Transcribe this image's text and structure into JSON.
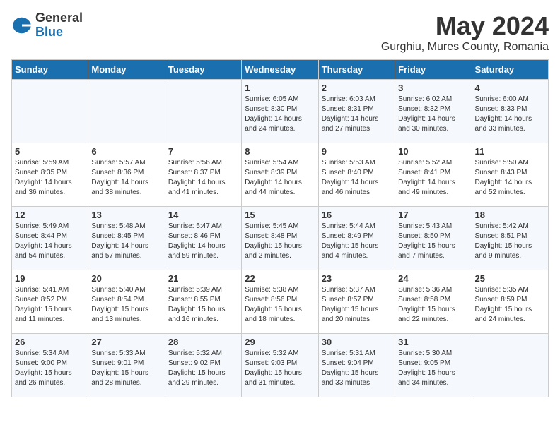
{
  "logo": {
    "general": "General",
    "blue": "Blue"
  },
  "title": "May 2024",
  "subtitle": "Gurghiu, Mures County, Romania",
  "headers": [
    "Sunday",
    "Monday",
    "Tuesday",
    "Wednesday",
    "Thursday",
    "Friday",
    "Saturday"
  ],
  "weeks": [
    [
      {
        "day": "",
        "info": ""
      },
      {
        "day": "",
        "info": ""
      },
      {
        "day": "",
        "info": ""
      },
      {
        "day": "1",
        "info": "Sunrise: 6:05 AM\nSunset: 8:30 PM\nDaylight: 14 hours\nand 24 minutes."
      },
      {
        "day": "2",
        "info": "Sunrise: 6:03 AM\nSunset: 8:31 PM\nDaylight: 14 hours\nand 27 minutes."
      },
      {
        "day": "3",
        "info": "Sunrise: 6:02 AM\nSunset: 8:32 PM\nDaylight: 14 hours\nand 30 minutes."
      },
      {
        "day": "4",
        "info": "Sunrise: 6:00 AM\nSunset: 8:33 PM\nDaylight: 14 hours\nand 33 minutes."
      }
    ],
    [
      {
        "day": "5",
        "info": "Sunrise: 5:59 AM\nSunset: 8:35 PM\nDaylight: 14 hours\nand 36 minutes."
      },
      {
        "day": "6",
        "info": "Sunrise: 5:57 AM\nSunset: 8:36 PM\nDaylight: 14 hours\nand 38 minutes."
      },
      {
        "day": "7",
        "info": "Sunrise: 5:56 AM\nSunset: 8:37 PM\nDaylight: 14 hours\nand 41 minutes."
      },
      {
        "day": "8",
        "info": "Sunrise: 5:54 AM\nSunset: 8:39 PM\nDaylight: 14 hours\nand 44 minutes."
      },
      {
        "day": "9",
        "info": "Sunrise: 5:53 AM\nSunset: 8:40 PM\nDaylight: 14 hours\nand 46 minutes."
      },
      {
        "day": "10",
        "info": "Sunrise: 5:52 AM\nSunset: 8:41 PM\nDaylight: 14 hours\nand 49 minutes."
      },
      {
        "day": "11",
        "info": "Sunrise: 5:50 AM\nSunset: 8:43 PM\nDaylight: 14 hours\nand 52 minutes."
      }
    ],
    [
      {
        "day": "12",
        "info": "Sunrise: 5:49 AM\nSunset: 8:44 PM\nDaylight: 14 hours\nand 54 minutes."
      },
      {
        "day": "13",
        "info": "Sunrise: 5:48 AM\nSunset: 8:45 PM\nDaylight: 14 hours\nand 57 minutes."
      },
      {
        "day": "14",
        "info": "Sunrise: 5:47 AM\nSunset: 8:46 PM\nDaylight: 14 hours\nand 59 minutes."
      },
      {
        "day": "15",
        "info": "Sunrise: 5:45 AM\nSunset: 8:48 PM\nDaylight: 15 hours\nand 2 minutes."
      },
      {
        "day": "16",
        "info": "Sunrise: 5:44 AM\nSunset: 8:49 PM\nDaylight: 15 hours\nand 4 minutes."
      },
      {
        "day": "17",
        "info": "Sunrise: 5:43 AM\nSunset: 8:50 PM\nDaylight: 15 hours\nand 7 minutes."
      },
      {
        "day": "18",
        "info": "Sunrise: 5:42 AM\nSunset: 8:51 PM\nDaylight: 15 hours\nand 9 minutes."
      }
    ],
    [
      {
        "day": "19",
        "info": "Sunrise: 5:41 AM\nSunset: 8:52 PM\nDaylight: 15 hours\nand 11 minutes."
      },
      {
        "day": "20",
        "info": "Sunrise: 5:40 AM\nSunset: 8:54 PM\nDaylight: 15 hours\nand 13 minutes."
      },
      {
        "day": "21",
        "info": "Sunrise: 5:39 AM\nSunset: 8:55 PM\nDaylight: 15 hours\nand 16 minutes."
      },
      {
        "day": "22",
        "info": "Sunrise: 5:38 AM\nSunset: 8:56 PM\nDaylight: 15 hours\nand 18 minutes."
      },
      {
        "day": "23",
        "info": "Sunrise: 5:37 AM\nSunset: 8:57 PM\nDaylight: 15 hours\nand 20 minutes."
      },
      {
        "day": "24",
        "info": "Sunrise: 5:36 AM\nSunset: 8:58 PM\nDaylight: 15 hours\nand 22 minutes."
      },
      {
        "day": "25",
        "info": "Sunrise: 5:35 AM\nSunset: 8:59 PM\nDaylight: 15 hours\nand 24 minutes."
      }
    ],
    [
      {
        "day": "26",
        "info": "Sunrise: 5:34 AM\nSunset: 9:00 PM\nDaylight: 15 hours\nand 26 minutes."
      },
      {
        "day": "27",
        "info": "Sunrise: 5:33 AM\nSunset: 9:01 PM\nDaylight: 15 hours\nand 28 minutes."
      },
      {
        "day": "28",
        "info": "Sunrise: 5:32 AM\nSunset: 9:02 PM\nDaylight: 15 hours\nand 29 minutes."
      },
      {
        "day": "29",
        "info": "Sunrise: 5:32 AM\nSunset: 9:03 PM\nDaylight: 15 hours\nand 31 minutes."
      },
      {
        "day": "30",
        "info": "Sunrise: 5:31 AM\nSunset: 9:04 PM\nDaylight: 15 hours\nand 33 minutes."
      },
      {
        "day": "31",
        "info": "Sunrise: 5:30 AM\nSunset: 9:05 PM\nDaylight: 15 hours\nand 34 minutes."
      },
      {
        "day": "",
        "info": ""
      }
    ]
  ]
}
